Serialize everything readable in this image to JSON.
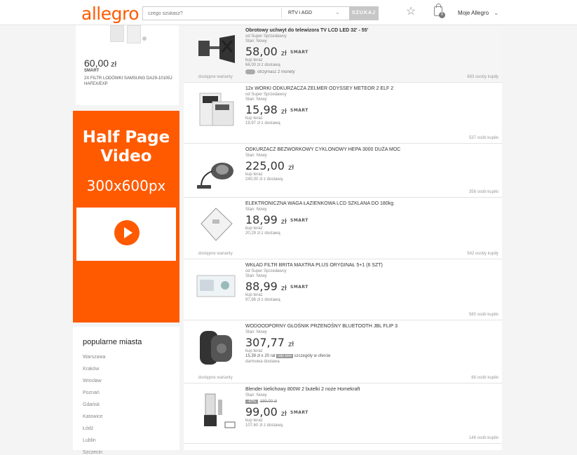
{
  "header": {
    "logo": "allegro",
    "search_placeholder": "czego szukasz?",
    "category": "RTV i AGD",
    "search_button": "SZUKAJ",
    "cart_count": "0",
    "account_label": "Moje Allegro"
  },
  "left_product": {
    "price_int": "60,00",
    "price_cur": " zł",
    "smart": "SMART",
    "description": "2X FILTR LODÓWKI SAMSUNG DA29-10105J HAFEX/EXP"
  },
  "ad": {
    "title": "Half Page Video",
    "size": "300x600px"
  },
  "cities": {
    "heading": "popularne miasta",
    "items": [
      "Warszawa",
      "Kraków",
      "Wrocław",
      "Poznań",
      "Gdańsk",
      "Katowice",
      "Łódź",
      "Lublin",
      "Szczecin"
    ]
  },
  "listings": [
    {
      "title": "Obrotowy uchwyt do telewizora TV LCD LED 32' - 55'",
      "seller": "od  Super Sprzedawcy",
      "condition": "Stan: Nowy",
      "price": "58,00",
      "currency": "zł",
      "smart": "SMART",
      "buy": "kup teraz",
      "shipping": "66,00 zł z dostawą",
      "coins": "otrzymasz 2 monety",
      "variants": "dostępne warianty",
      "bought": "683 osoby kupiły"
    },
    {
      "title": "12x WORKI ODKURZACZA ZELMER ODYSSEY METEOR 2 ELF 2",
      "seller": "od  Super Sprzedawcy",
      "condition": "Stan: Nowy",
      "price": "15,98",
      "currency": "zł",
      "smart": "SMART",
      "buy": "kup teraz",
      "shipping": "19,97 zł z dostawą",
      "bought": "537 osób kupiło"
    },
    {
      "title": "ODKURZACZ BEZWORKOWY CYKLONOWY HEPA 3000 DUŻA MOC",
      "condition": "Stan: Nowy",
      "price": "225,00",
      "currency": "zł",
      "buy": "kup teraz",
      "shipping": "240,00 zł z dostawą",
      "bought": "358 osób kupiło"
    },
    {
      "title": "ELEKTRONICZNA WAGA ŁAZIENKOWA LCD SZKLANA DO 180kg",
      "condition": "Stan: Nowy",
      "price": "18,99",
      "currency": "zł",
      "smart": "SMART",
      "buy": "kup teraz",
      "shipping": "20,29 zł z dostawą",
      "variants": "dostępne warianty",
      "bought": "542 osoby kupiły"
    },
    {
      "title": "WKŁAD FILTR BRITA MAXTRA PLUS ORYGINAŁ 5+1 (6 SZT)",
      "seller": "od  Super Sprzedawcy",
      "condition": "Stan: Nowy",
      "price": "88,99",
      "currency": "zł",
      "smart": "SMART",
      "buy": "kup teraz",
      "shipping": "97,98 zł z dostawą",
      "bought": "580 osób kupiło"
    },
    {
      "title": "WODOODPORNY GŁOŚNIK PRZENOŚNY BLUETOOTH JBL FLIP 3",
      "condition": "Stan: Nowy",
      "price": "307,77",
      "currency": "zł",
      "buy": "kup teraz",
      "installments": "15,39 zł x 20 rat",
      "raty_badge": "raty zero",
      "installments_more": "szczegóły w ofercie",
      "shipping": "darmowa dostawa",
      "variants": "dostępne warianty",
      "bought": "88 osób kupiło"
    },
    {
      "title": "Blender kielichowy 800W 2 butelki 2 noże Homekraft",
      "condition": "Stan: Nowy",
      "discount": "-47%",
      "old_price": "189,00 zł",
      "price": "99,00",
      "currency": "zł",
      "smart": "SMART",
      "buy": "kup teraz",
      "shipping": "107,60 zł z dostawą",
      "bought": "146 osób kupiło"
    }
  ]
}
